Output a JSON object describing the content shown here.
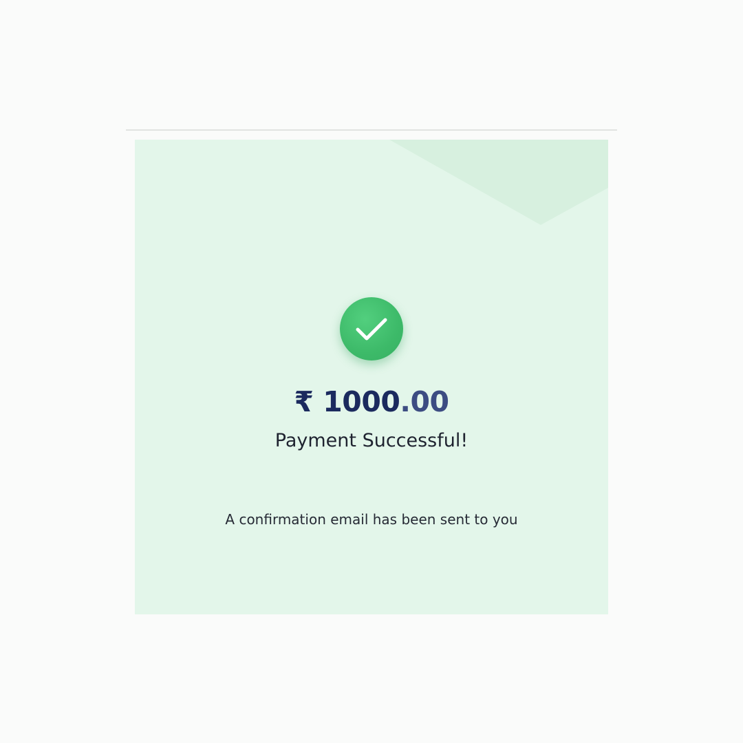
{
  "payment": {
    "currency_symbol": "₹",
    "amount_whole": "1000",
    "amount_decimal": ".00",
    "status": "Payment Successful!",
    "confirmation_message": "A confirmation email has been sent to you"
  },
  "icons": {
    "status_icon": "check-circle-icon"
  },
  "colors": {
    "success_green": "#3dba69",
    "amount_navy": "#1b2a5e",
    "card_background": "#e3f6ea"
  }
}
